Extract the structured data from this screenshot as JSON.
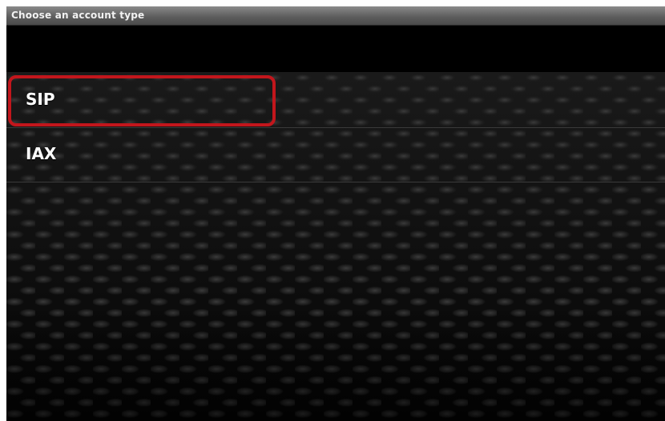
{
  "dialog": {
    "title": "Choose an account type"
  },
  "list": {
    "items": [
      {
        "label": "SIP"
      },
      {
        "label": "IAX"
      }
    ]
  },
  "annotation": {
    "highlight_color": "#c2161c"
  },
  "colors": {
    "background": "#000000",
    "title_bar": "#6a6a6a",
    "text": "#ffffff"
  }
}
